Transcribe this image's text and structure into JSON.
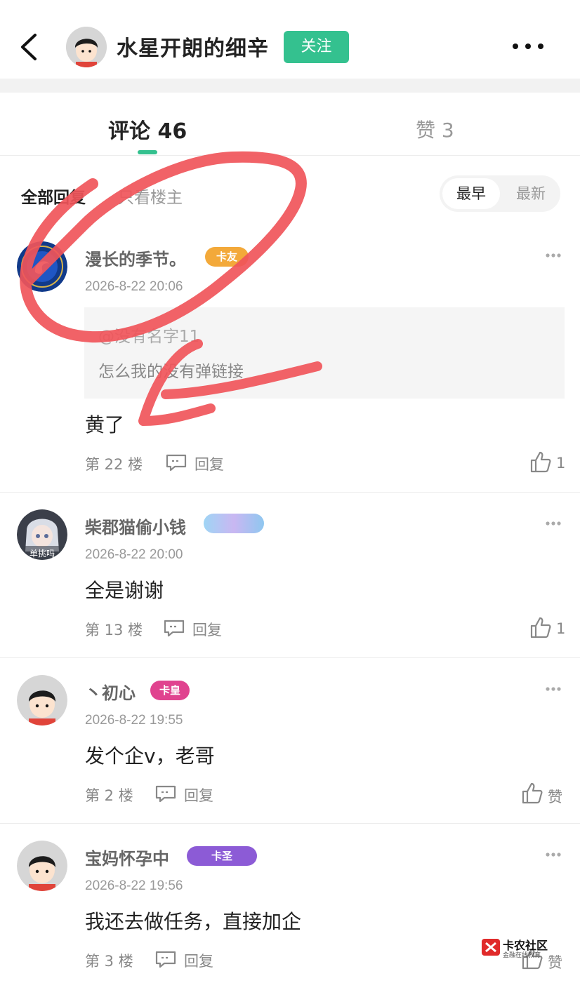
{
  "header": {
    "username": "水星开朗的细辛",
    "follow_label": "关注",
    "back_icon": "chevron-left-icon",
    "more_icon": "more-dots-icon"
  },
  "tabs": {
    "comments_label": "评论 46",
    "likes_label": "赞 3"
  },
  "filter": {
    "all_label": "全部回复",
    "owner_label": "只看楼主",
    "sort_early": "最早",
    "sort_new": "最新"
  },
  "comments": [
    {
      "name": "漫长的季节。",
      "badge": "卡友",
      "date": "2026-8-22 20:06",
      "quote_at": "@没有名字11",
      "quote_text": "怎么我的没有弹链接",
      "text": "黄了",
      "floor": "第 22 楼",
      "reply": "回复",
      "likes": "1"
    },
    {
      "name": "柴郡猫偷小钱",
      "badge": "",
      "avatar_text": "单挑吗",
      "date": "2026-8-22 20:00",
      "text": "全是谢谢",
      "floor": "第 13 楼",
      "reply": "回复",
      "likes": "1"
    },
    {
      "name": "丶初心",
      "badge": "卡皇",
      "date": "2026-8-22 19:55",
      "text": "发个企v，老哥",
      "floor": "第 2 楼",
      "reply": "回复",
      "likes": "赞"
    },
    {
      "name": "宝妈怀孕中",
      "badge": "卡圣",
      "date": "2026-8-22 19:56",
      "text": "我还去做任务，直接加企",
      "floor": "第 3 楼",
      "reply": "回复",
      "likes": "赞"
    }
  ],
  "watermark": {
    "title": "卡农社区",
    "subtitle": "金融在线教育"
  },
  "colors": {
    "accent": "#34c18f",
    "annotation": "#f0555a"
  }
}
